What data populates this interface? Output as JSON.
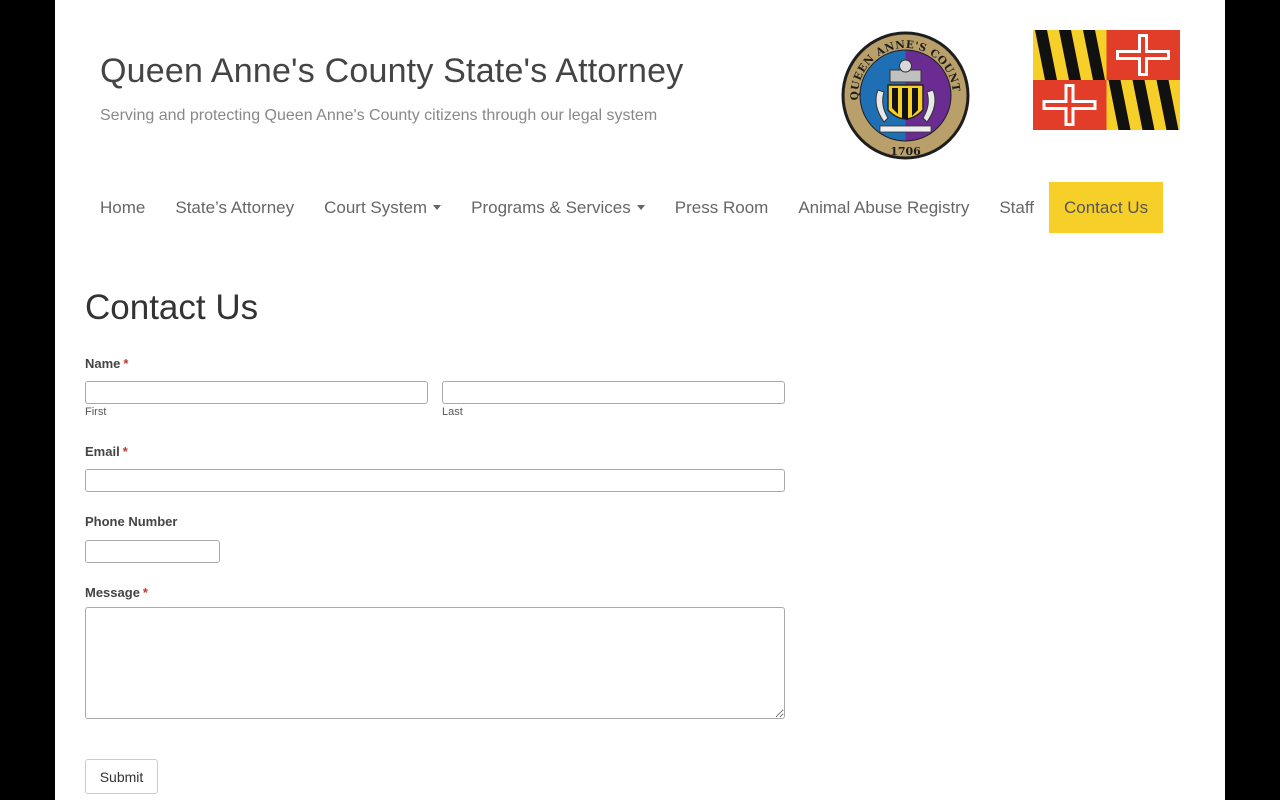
{
  "header": {
    "title": "Queen Anne's County State's Attorney",
    "description": "Serving and protecting Queen Anne's County citizens through our legal system",
    "seal": {
      "top_text": "QUEEN ANNE'S COUNTY",
      "year": "1706"
    }
  },
  "nav": {
    "items": [
      {
        "label": "Home",
        "dropdown": false,
        "active": false
      },
      {
        "label": "State’s Attorney",
        "dropdown": false,
        "active": false
      },
      {
        "label": "Court System",
        "dropdown": true,
        "active": false
      },
      {
        "label": "Programs & Services",
        "dropdown": true,
        "active": false
      },
      {
        "label": "Press Room",
        "dropdown": false,
        "active": false
      },
      {
        "label": "Animal Abuse Registry",
        "dropdown": false,
        "active": false
      },
      {
        "label": "Staff",
        "dropdown": false,
        "active": false
      },
      {
        "label": "Contact Us",
        "dropdown": false,
        "active": true
      }
    ]
  },
  "main": {
    "title": "Contact Us",
    "form": {
      "required_mark": "*",
      "name_label": "Name",
      "first_sublabel": "First",
      "last_sublabel": "Last",
      "first_value": "",
      "last_value": "",
      "email_label": "Email",
      "email_value": "",
      "phone_label": "Phone Number",
      "phone_value": "",
      "message_label": "Message",
      "message_value": "",
      "submit_label": "Submit"
    }
  },
  "colors": {
    "active_nav": "#f7cf29",
    "required": "#c0392b",
    "flag_gold": "#f7cf29",
    "flag_black": "#111111",
    "flag_red": "#e23d28",
    "seal_blue": "#1f6fb5",
    "seal_purple": "#6a2c91",
    "seal_gold": "#b99f6a"
  }
}
